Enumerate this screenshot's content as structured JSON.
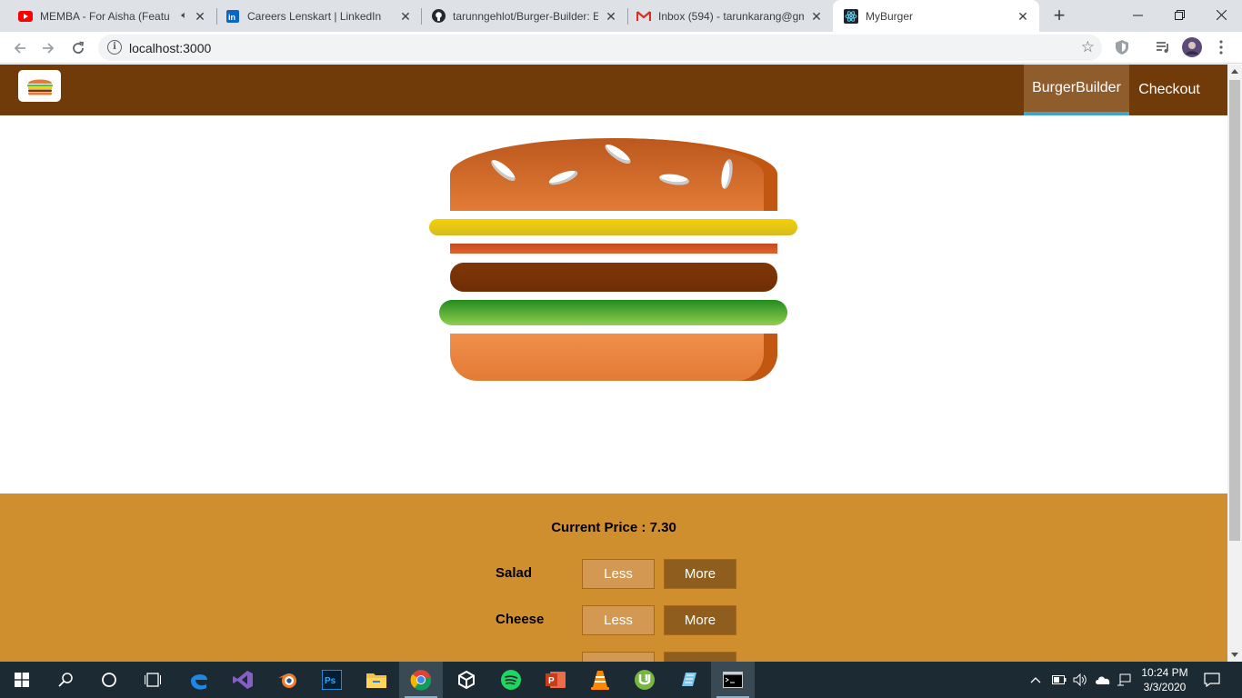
{
  "browser": {
    "tabs": [
      {
        "label": "MEMBA - For Aisha (Featu",
        "icon": "youtube-icon",
        "audio": true
      },
      {
        "label": "Careers Lenskart | LinkedIn",
        "icon": "linkedin-icon"
      },
      {
        "label": "tarunngehlot/Burger-Builder: E",
        "icon": "github-icon"
      },
      {
        "label": "Inbox (594) - tarunkarang@gm",
        "icon": "gmail-icon"
      },
      {
        "label": "MyBurger",
        "icon": "react-icon",
        "active": true
      }
    ],
    "url": "localhost:3000"
  },
  "app": {
    "nav": [
      {
        "label": "BurgerBuilder",
        "active": true
      },
      {
        "label": "Checkout",
        "active": false
      }
    ],
    "price_label": "Current Price",
    "price_value": "7.30",
    "controls": [
      {
        "label": "Salad",
        "less": "Less",
        "more": "More"
      },
      {
        "label": "Cheese",
        "less": "Less",
        "more": "More"
      },
      {
        "label": "",
        "less": "",
        "more": ""
      }
    ],
    "colors": {
      "header": "#703b09",
      "controls_bg": "#cf8f2e",
      "nav_active": "#8f5c2c",
      "nav_underline": "#40a4c8"
    }
  },
  "taskbar": {
    "time": "10:24 PM",
    "date": "3/3/2020",
    "apps": [
      "start-icon",
      "search-icon",
      "cortana-icon",
      "task-view-icon",
      "edge-icon",
      "visual-studio-icon",
      "blender-icon",
      "photoshop-icon",
      "file-explorer-icon",
      "chrome-icon",
      "unity-icon",
      "spotify-icon",
      "powerpoint-icon",
      "vlc-icon",
      "utorrent-icon",
      "notepad-icon",
      "terminal-icon"
    ]
  }
}
